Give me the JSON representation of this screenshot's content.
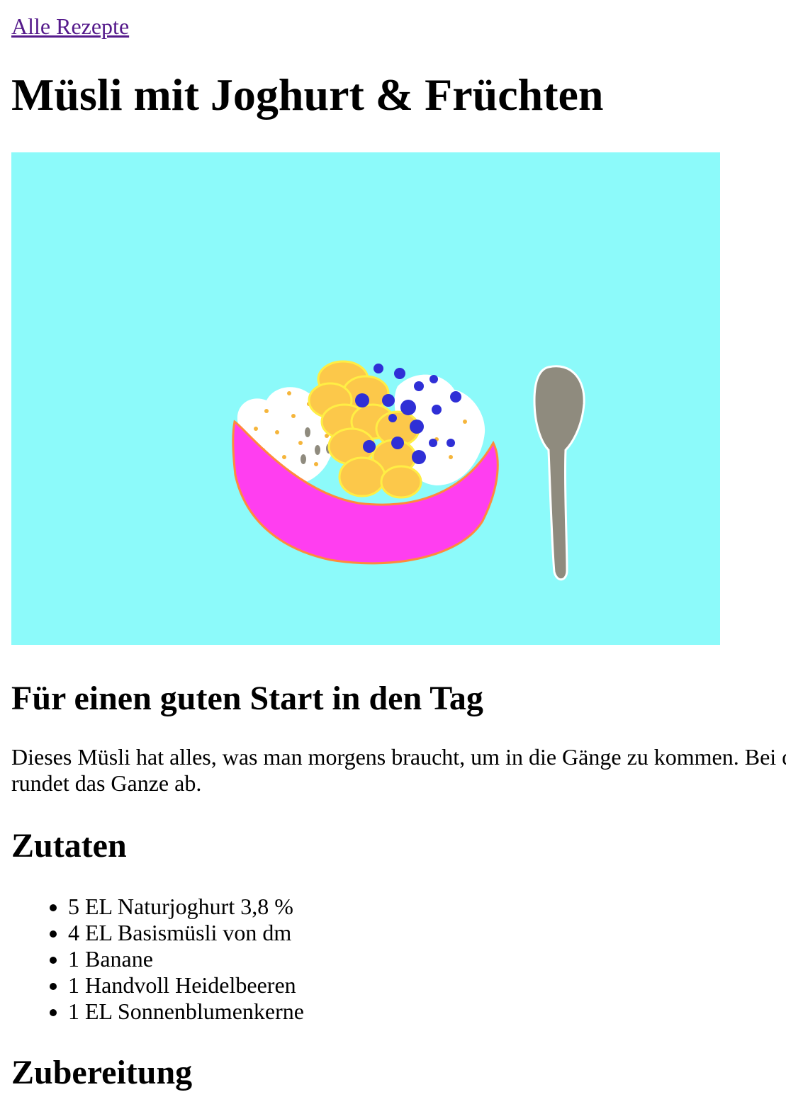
{
  "nav": {
    "back_link": "Alle Rezepte"
  },
  "recipe": {
    "title": "Müsli mit Joghurt & Früchten",
    "subtitle": "Für einen guten Start in den Tag",
    "intro_line1": "Dieses Müsli hat alles, was man morgens braucht, um in die Gänge zu kommen. Bei d",
    "intro_line2": "rundet das Ganze ab.",
    "ingredients_heading": "Zutaten",
    "ingredients": [
      "5 EL Naturjoghurt 3,8 %",
      "4 EL Basismüsli von dm",
      "1 Banane",
      "1 Handvoll Heidelbeeren",
      "1 EL Sonnenblumenkerne"
    ],
    "preparation_heading": "Zubereitung"
  },
  "illustration": {
    "background_color": "#8cfafa",
    "bowl_color": "#ff3ef0",
    "bowl_rim_color": "#ff8a3c",
    "banana_color": "#fcc84a",
    "blueberry_color": "#2f2fd6",
    "spoon_color": "#8f8b7e"
  }
}
